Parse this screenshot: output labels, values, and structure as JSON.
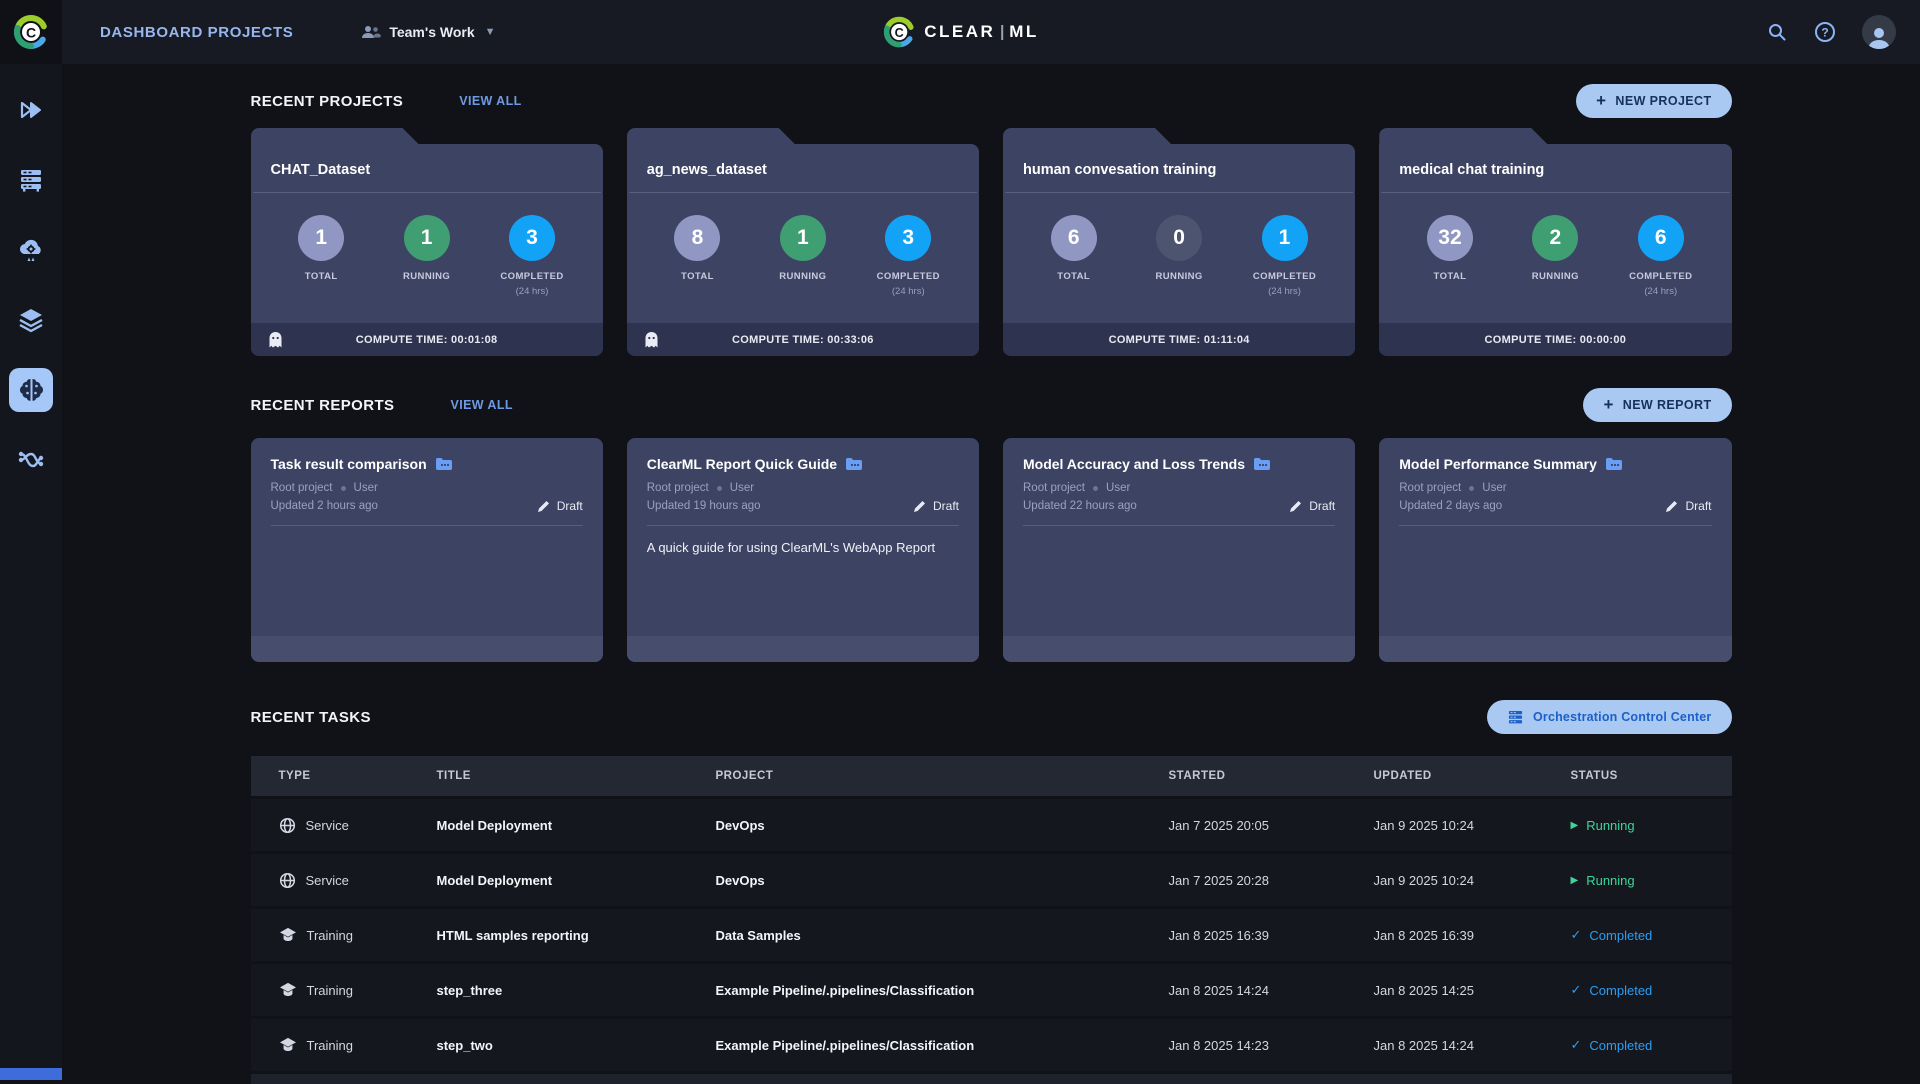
{
  "topbar": {
    "title": "DASHBOARD PROJECTS",
    "workspace": "Team's Work",
    "logo_left": "CLEAR",
    "logo_right": "ML"
  },
  "sidebar": {
    "items": [
      "projects-icon",
      "workers-queues-icon",
      "applications-icon",
      "datasets-icon",
      "models-icon",
      "pipelines-icon"
    ],
    "active_index": 4
  },
  "projects": {
    "heading": "RECENT PROJECTS",
    "view_all": "VIEW ALL",
    "new_button": "NEW PROJECT",
    "labels": {
      "total": "TOTAL",
      "running": "RUNNING",
      "completed": "COMPLETED",
      "window": "(24 hrs)"
    },
    "cards": [
      {
        "name": "CHAT_Dataset",
        "total": "1",
        "running": "1",
        "completed": "3",
        "compute": "COMPUTE TIME: 00:01:08",
        "ghost": true
      },
      {
        "name": "ag_news_dataset",
        "total": "8",
        "running": "1",
        "completed": "3",
        "compute": "COMPUTE TIME: 00:33:06",
        "ghost": true
      },
      {
        "name": "human convesation training",
        "total": "6",
        "running": "0",
        "completed": "1",
        "compute": "COMPUTE TIME: 01:11:04",
        "ghost": false
      },
      {
        "name": "medical chat training",
        "total": "32",
        "running": "2",
        "completed": "6",
        "compute": "COMPUTE TIME: 00:00:00",
        "ghost": false
      }
    ]
  },
  "reports": {
    "heading": "RECENT REPORTS",
    "view_all": "VIEW ALL",
    "new_button": "NEW REPORT",
    "cards": [
      {
        "title": "Task result comparison",
        "project": "Root project",
        "author": "User",
        "updated": "Updated 2 hours ago",
        "status": "Draft",
        "description": ""
      },
      {
        "title": "ClearML Report Quick Guide",
        "project": "Root project",
        "author": "User",
        "updated": "Updated 19 hours ago",
        "status": "Draft",
        "description": "A quick guide for using ClearML's WebApp Report"
      },
      {
        "title": "Model Accuracy and Loss Trends",
        "project": "Root project",
        "author": "User",
        "updated": "Updated 22 hours ago",
        "status": "Draft",
        "description": ""
      },
      {
        "title": "Model Performance Summary",
        "project": "Root project",
        "author": "User",
        "updated": "Updated 2 days ago",
        "status": "Draft",
        "description": ""
      }
    ]
  },
  "tasks": {
    "heading": "RECENT TASKS",
    "occ_button": "Orchestration Control Center",
    "columns": [
      "TYPE",
      "TITLE",
      "PROJECT",
      "STARTED",
      "UPDATED",
      "STATUS"
    ],
    "rows": [
      {
        "type": "Service",
        "title": "Model Deployment",
        "project": "DevOps",
        "started": "Jan 7 2025 20:05",
        "updated": "Jan 9 2025 10:24",
        "status": "Running"
      },
      {
        "type": "Service",
        "title": "Model Deployment",
        "project": "DevOps",
        "started": "Jan 7 2025 20:28",
        "updated": "Jan 9 2025 10:24",
        "status": "Running"
      },
      {
        "type": "Training",
        "title": "HTML samples reporting",
        "project": "Data Samples",
        "started": "Jan 8 2025 16:39",
        "updated": "Jan 8 2025 16:39",
        "status": "Completed"
      },
      {
        "type": "Training",
        "title": "step_three",
        "project": "Example Pipeline/.pipelines/Classification",
        "started": "Jan 8 2025 14:24",
        "updated": "Jan 8 2025 14:25",
        "status": "Completed"
      },
      {
        "type": "Training",
        "title": "step_two",
        "project": "Example Pipeline/.pipelines/Classification",
        "started": "Jan 8 2025 14:23",
        "updated": "Jan 8 2025 14:24",
        "status": "Completed"
      }
    ]
  },
  "colors": {
    "accent_button": "#a9c8f2",
    "stat_total": "#9097c2",
    "stat_running": "#3f9e72",
    "stat_zero": "#4c546f",
    "stat_completed": "#12a3f7",
    "status_running": "#3ed598",
    "status_completed": "#2a9df4",
    "card_bg": "#3d4362",
    "topbar_bg": "#171a22",
    "page_bg": "#101218"
  }
}
